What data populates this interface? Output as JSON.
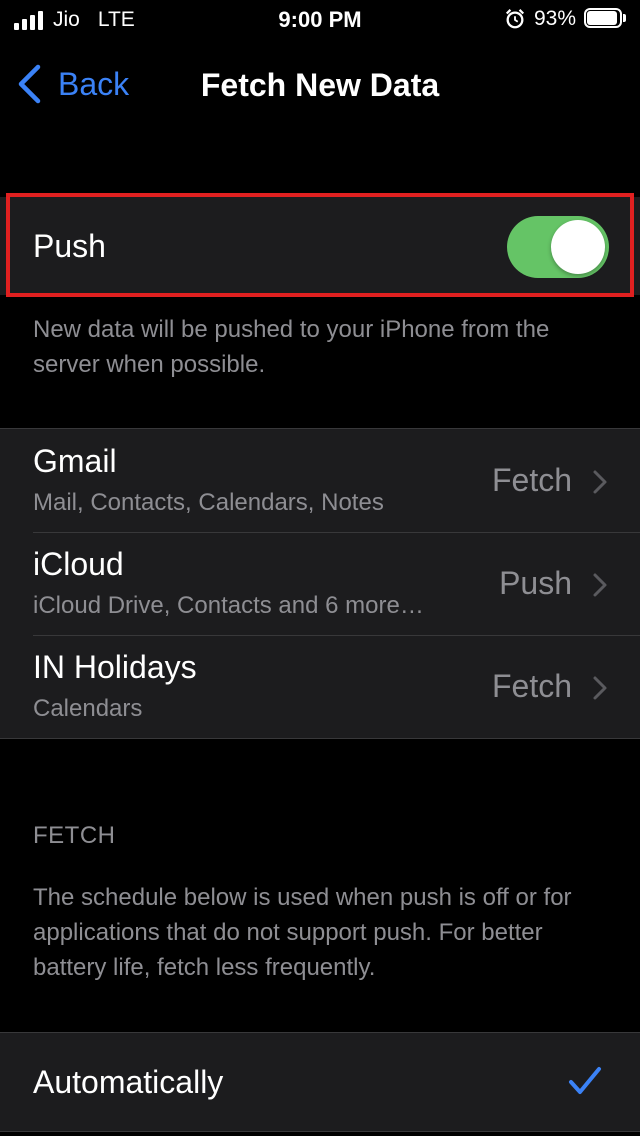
{
  "status_bar": {
    "carrier": "Jio",
    "network": "LTE",
    "time": "9:00 PM",
    "battery": "93%",
    "battery_level": 0.93
  },
  "nav": {
    "back_label": "Back",
    "title": "Fetch New Data"
  },
  "push": {
    "label": "Push",
    "enabled": true,
    "description": "New data will be pushed to your iPhone from the server when possible."
  },
  "accounts": [
    {
      "name": "Gmail",
      "services": "Mail, Contacts, Calendars, Notes",
      "mode": "Fetch"
    },
    {
      "name": "iCloud",
      "services": "iCloud Drive, Contacts and 6 more…",
      "mode": "Push"
    },
    {
      "name": "IN Holidays",
      "services": "Calendars",
      "mode": "Fetch"
    }
  ],
  "fetch": {
    "header": "FETCH",
    "description": "The schedule below is used when push is off or for applications that do not support push. For better battery life, fetch less frequently.",
    "options": [
      {
        "label": "Automatically",
        "selected": true
      }
    ]
  },
  "colors": {
    "accent": "#3b82f6",
    "toggle_on": "#65c466",
    "highlight": "#e02020"
  }
}
